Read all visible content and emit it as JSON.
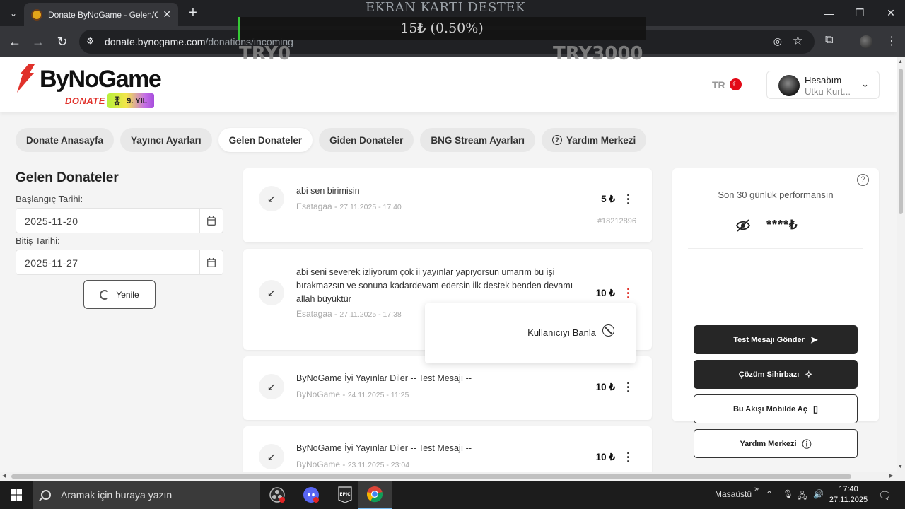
{
  "browser": {
    "tab_title": "Donate ByNoGame - Gelen/Gid",
    "url_host": "donate.bynogame.com",
    "url_path": "/donations/incoming"
  },
  "overlay": {
    "title": "EKRAN KARTI DESTEK",
    "amount": "15₺ (0.50%)",
    "progress": 0.005,
    "min_label": "TRY0",
    "max_label": "TRY3000"
  },
  "header": {
    "logo_name": "ByNoGame",
    "logo_sub": "DONATE",
    "badge": "9. YIL",
    "lang": "TR",
    "account_title": "Hesabım",
    "account_name": "Utku Kurt..."
  },
  "nav": {
    "pills": [
      {
        "label": "Donate Anasayfa"
      },
      {
        "label": "Yayıncı Ayarları"
      },
      {
        "label": "Gelen Donateler"
      },
      {
        "label": "Giden Donateler"
      },
      {
        "label": "BNG Stream Ayarları"
      },
      {
        "label": "Yardım Merkezi"
      }
    ]
  },
  "filter": {
    "title": "Gelen Donateler",
    "start_label": "Başlangıç Tarihi:",
    "start_value": "2025-11-20",
    "end_label": "Bitiş Tarihi:",
    "end_value": "2025-11-27",
    "refresh_label": "Yenile"
  },
  "donations": [
    {
      "message": "abi sen birimisin",
      "sender": "Esatagaa",
      "date": "27.11.2025 - 17:40",
      "amount": "5 ₺",
      "id": "#18212896"
    },
    {
      "message": "abi seni severek izliyorum çok ii yayınlar yapıyorsun umarım bu işi bırakmazsın ve sonuna kadardevam edersin ilk destek benden devamı allah büyüktür",
      "sender": "Esatagaa",
      "date": "27.11.2025 - 17:38",
      "amount": "10 ₺",
      "id": ""
    },
    {
      "message": "ByNoGame İyi Yayınlar Diler -- Test Mesajı --",
      "sender": "ByNoGame",
      "date": "24.11.2025 - 11:25",
      "amount": "10 ₺",
      "id": ""
    },
    {
      "message": "ByNoGame İyi Yayınlar Diler -- Test Mesajı --",
      "sender": "ByNoGame",
      "date": "23.11.2025 - 23:04",
      "amount": "10 ₺",
      "id": ""
    }
  ],
  "popup": {
    "ban_label": "Kullanıcıyı Banla"
  },
  "performance": {
    "title": "Son 30 günlük performansın",
    "hidden_value": "****₺",
    "buttons": {
      "test": "Test Mesajı Gönder",
      "wizard": "Çözüm Sihirbazı",
      "mobile": "Bu Akışı Mobilde Aç",
      "help": "Yardım Merkezi"
    }
  },
  "taskbar": {
    "search_placeholder": "Aramak için buraya yazın",
    "desktop_label": "Masaüstü",
    "time": "17:40",
    "date": "27.11.2025"
  },
  "colors": {
    "brand_red": "#e0312a",
    "dark_button": "#262626",
    "progress_green": "#35c935"
  }
}
